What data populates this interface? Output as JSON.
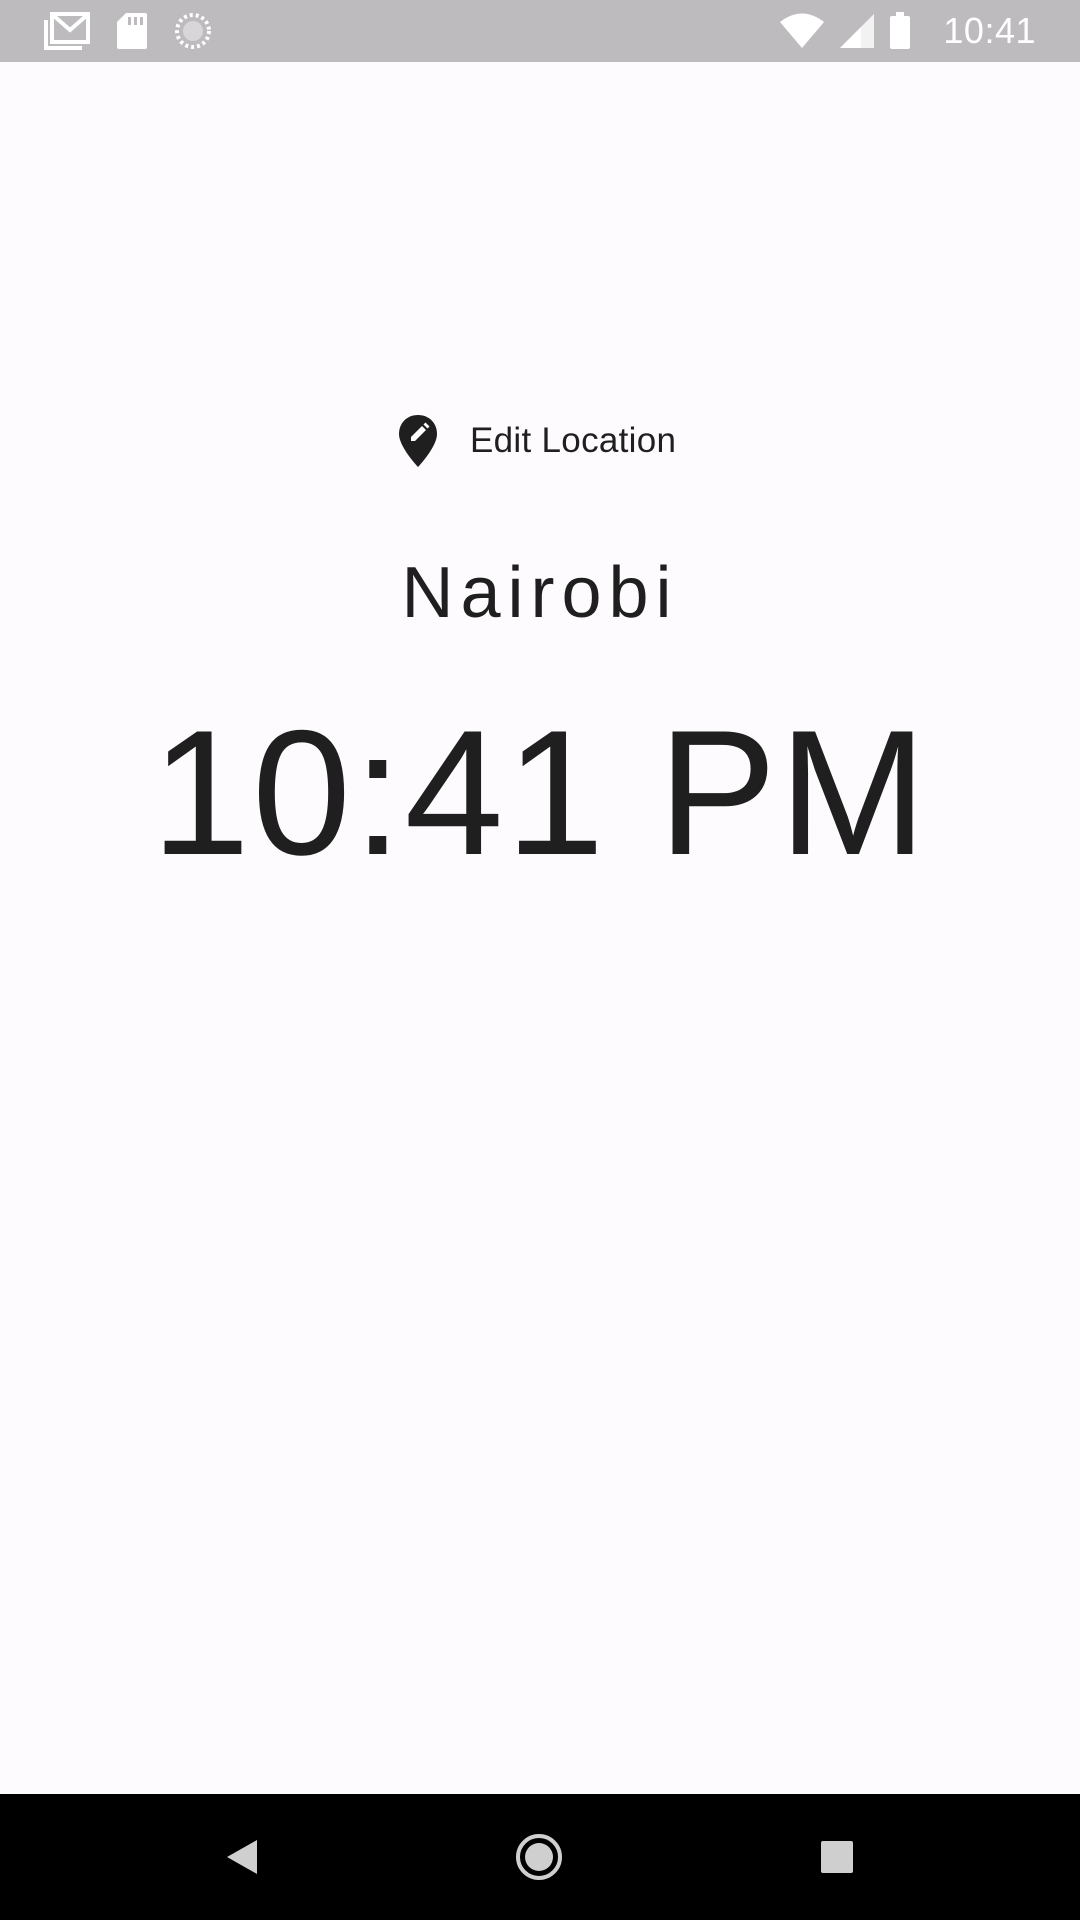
{
  "status_bar": {
    "time": "10:41",
    "left_icons": [
      "gmail-icon",
      "sd-card-icon",
      "sync-icon"
    ],
    "right_icons": [
      "wifi-icon",
      "signal-icon",
      "battery-icon"
    ],
    "background": "#bdbbbe"
  },
  "main": {
    "edit_location_label": "Edit Location",
    "location_icon": "edit-location-icon",
    "city": "Nairobi",
    "time": "10:41 PM",
    "background": "#fdfbfd",
    "text_color": "#1f1f1f"
  },
  "nav_bar": {
    "buttons": [
      "back-icon",
      "home-icon",
      "recents-icon"
    ],
    "background": "#000000"
  }
}
